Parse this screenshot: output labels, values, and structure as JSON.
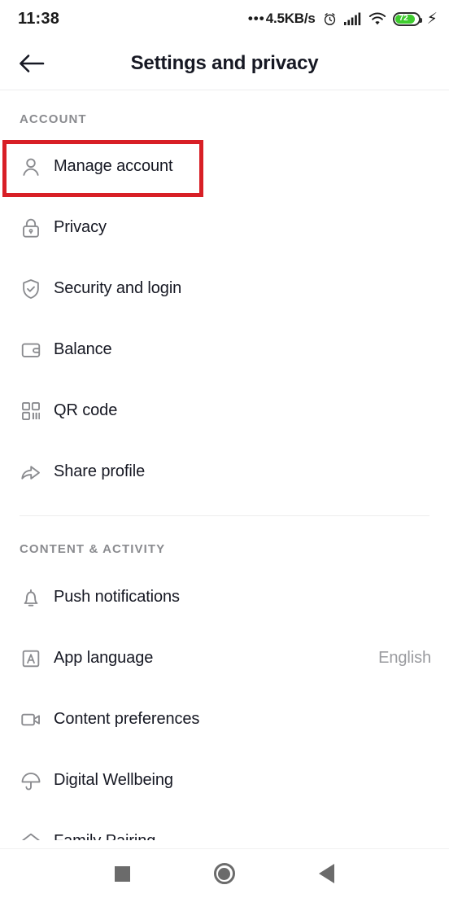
{
  "statusbar": {
    "time": "11:38",
    "net_speed": "4.5KB/s",
    "dots": "•••",
    "alarm_icon": "alarm-clock-icon",
    "signal_icon": "signal-bars-icon",
    "wifi_icon": "wifi-icon",
    "battery_level": "72",
    "battery_color": "#3fcc2f",
    "charging_icon": "charging-bolt-icon"
  },
  "header": {
    "title": "Settings and privacy",
    "back_icon": "back-arrow-icon"
  },
  "highlight": {
    "color": "#d81f26",
    "target": "Manage account"
  },
  "sections": [
    {
      "label": "ACCOUNT",
      "rows": [
        {
          "label": "Manage account",
          "icon": "person-icon",
          "value": ""
        },
        {
          "label": "Privacy",
          "icon": "lock-icon",
          "value": ""
        },
        {
          "label": "Security and login",
          "icon": "shield-check-icon",
          "value": ""
        },
        {
          "label": "Balance",
          "icon": "wallet-icon",
          "value": ""
        },
        {
          "label": "QR code",
          "icon": "qr-code-icon",
          "value": ""
        },
        {
          "label": "Share profile",
          "icon": "share-arrow-icon",
          "value": ""
        }
      ]
    },
    {
      "label": "CONTENT & ACTIVITY",
      "rows": [
        {
          "label": "Push notifications",
          "icon": "bell-icon",
          "value": ""
        },
        {
          "label": "App language",
          "icon": "language-a-icon",
          "value": "English"
        },
        {
          "label": "Content preferences",
          "icon": "video-camera-icon",
          "value": ""
        },
        {
          "label": "Digital Wellbeing",
          "icon": "umbrella-icon",
          "value": ""
        },
        {
          "label": "Family Pairing",
          "icon": "house-heart-icon",
          "value": ""
        }
      ]
    }
  ],
  "navbar": {
    "recents_icon": "square-recents-icon",
    "home_icon": "circle-home-icon",
    "back_icon": "triangle-back-icon"
  }
}
